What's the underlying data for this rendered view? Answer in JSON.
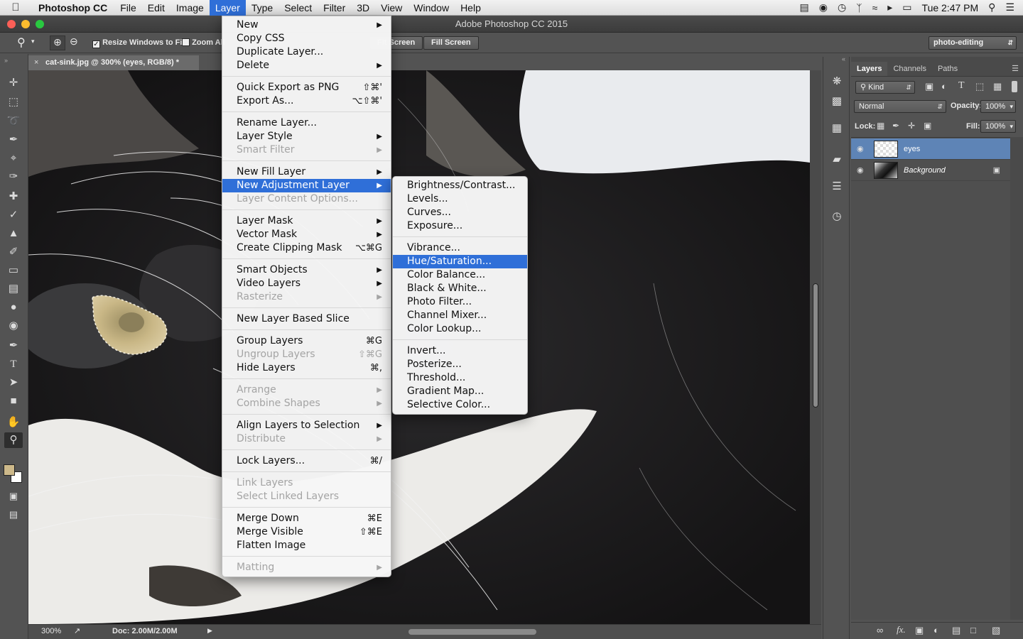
{
  "menubar": {
    "app_name": "Photoshop CC",
    "menus": [
      "File",
      "Edit",
      "Image",
      "Layer",
      "Type",
      "Select",
      "Filter",
      "3D",
      "View",
      "Window",
      "Help"
    ],
    "active_menu": "Layer",
    "clock": "Tue 2:47 PM"
  },
  "window": {
    "title": "Adobe Photoshop CC 2015"
  },
  "options": {
    "resize_windows": "Resize Windows to Fit",
    "zoom_all": "Zoom All",
    "fit_screen": "Fit Screen",
    "fill_screen": "Fill Screen",
    "workspace": "photo-editing"
  },
  "document": {
    "tab_title": "cat-sink.jpg @ 300% (eyes, RGB/8) *",
    "zoom": "300%",
    "doc_size": "Doc: 2.00M/2.00M"
  },
  "layers_panel": {
    "tabs": [
      "Layers",
      "Channels",
      "Paths"
    ],
    "filter_kind": "Kind",
    "blend_mode": "Normal",
    "opacity_label": "Opacity:",
    "opacity": "100%",
    "lock_label": "Lock:",
    "fill_label": "Fill:",
    "fill": "100%",
    "layers": [
      {
        "name": "eyes",
        "selected": true
      },
      {
        "name": "Background",
        "selected": false
      }
    ]
  },
  "layer_menu": [
    {
      "label": "New",
      "submenu": true
    },
    {
      "label": "Copy CSS"
    },
    {
      "label": "Duplicate Layer..."
    },
    {
      "label": "Delete",
      "submenu": true
    },
    {
      "sep": true
    },
    {
      "label": "Quick Export as PNG",
      "shortcut": "⇧⌘'"
    },
    {
      "label": "Export As...",
      "shortcut": "⌥⇧⌘'"
    },
    {
      "sep": true
    },
    {
      "label": "Rename Layer..."
    },
    {
      "label": "Layer Style",
      "submenu": true
    },
    {
      "label": "Smart Filter",
      "submenu": true,
      "disabled": true
    },
    {
      "sep": true
    },
    {
      "label": "New Fill Layer",
      "submenu": true
    },
    {
      "label": "New Adjustment Layer",
      "submenu": true,
      "highlighted": true
    },
    {
      "label": "Layer Content Options...",
      "disabled": true
    },
    {
      "sep": true
    },
    {
      "label": "Layer Mask",
      "submenu": true
    },
    {
      "label": "Vector Mask",
      "submenu": true
    },
    {
      "label": "Create Clipping Mask",
      "shortcut": "⌥⌘G"
    },
    {
      "sep": true
    },
    {
      "label": "Smart Objects",
      "submenu": true
    },
    {
      "label": "Video Layers",
      "submenu": true
    },
    {
      "label": "Rasterize",
      "submenu": true,
      "disabled": true
    },
    {
      "sep": true
    },
    {
      "label": "New Layer Based Slice"
    },
    {
      "sep": true
    },
    {
      "label": "Group Layers",
      "shortcut": "⌘G"
    },
    {
      "label": "Ungroup Layers",
      "shortcut": "⇧⌘G",
      "disabled": true
    },
    {
      "label": "Hide Layers",
      "shortcut": "⌘,"
    },
    {
      "sep": true
    },
    {
      "label": "Arrange",
      "submenu": true,
      "disabled": true
    },
    {
      "label": "Combine Shapes",
      "submenu": true,
      "disabled": true
    },
    {
      "sep": true
    },
    {
      "label": "Align Layers to Selection",
      "submenu": true
    },
    {
      "label": "Distribute",
      "submenu": true,
      "disabled": true
    },
    {
      "sep": true
    },
    {
      "label": "Lock Layers...",
      "shortcut": "⌘/"
    },
    {
      "sep": true
    },
    {
      "label": "Link Layers",
      "disabled": true
    },
    {
      "label": "Select Linked Layers",
      "disabled": true
    },
    {
      "sep": true
    },
    {
      "label": "Merge Down",
      "shortcut": "⌘E"
    },
    {
      "label": "Merge Visible",
      "shortcut": "⇧⌘E"
    },
    {
      "label": "Flatten Image"
    },
    {
      "sep": true
    },
    {
      "label": "Matting",
      "submenu": true,
      "disabled": true
    }
  ],
  "adjustment_submenu": [
    {
      "label": "Brightness/Contrast..."
    },
    {
      "label": "Levels..."
    },
    {
      "label": "Curves..."
    },
    {
      "label": "Exposure..."
    },
    {
      "sep": true
    },
    {
      "label": "Vibrance..."
    },
    {
      "label": "Hue/Saturation...",
      "highlighted": true
    },
    {
      "label": "Color Balance..."
    },
    {
      "label": "Black & White..."
    },
    {
      "label": "Photo Filter..."
    },
    {
      "label": "Channel Mixer..."
    },
    {
      "label": "Color Lookup..."
    },
    {
      "sep": true
    },
    {
      "label": "Invert..."
    },
    {
      "label": "Posterize..."
    },
    {
      "label": "Threshold..."
    },
    {
      "label": "Gradient Map..."
    },
    {
      "label": "Selective Color..."
    }
  ],
  "colors": {
    "highlight": "#2f6fd8",
    "selected_layer": "#5e84b6",
    "foreground_swatch": "#cdb98a"
  }
}
